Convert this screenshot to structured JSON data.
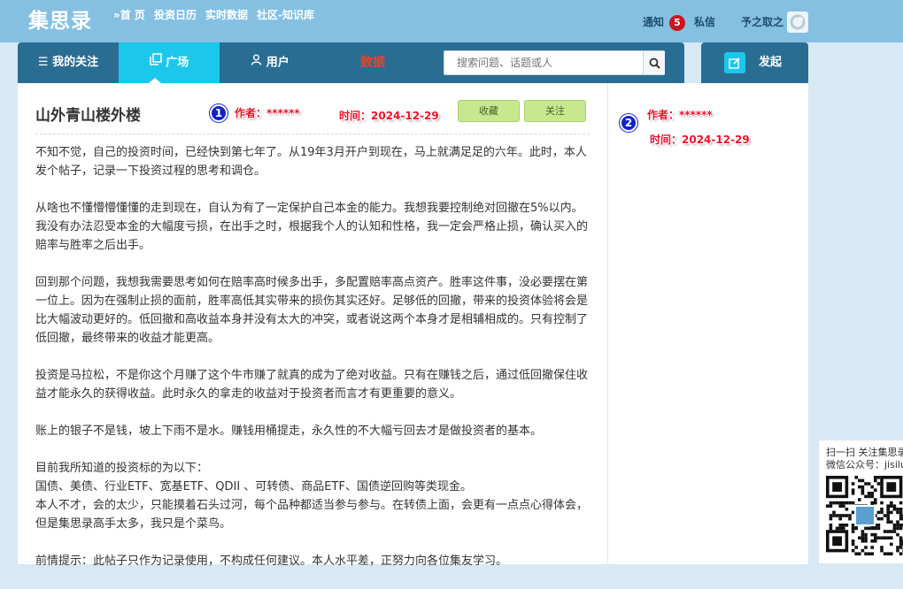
{
  "header": {
    "logo": "集思录",
    "nav": [
      "»首 页",
      "投资日历",
      "实时数据",
      "社区-知识库"
    ],
    "notice_label": "通知",
    "notice_count": "5",
    "message_label": "私信",
    "username": "予之取之"
  },
  "navbar": {
    "my_follow": "我的关注",
    "square": "广场",
    "users": "用户",
    "data": "数据",
    "search_placeholder": "搜索问题、话题或人",
    "post_button": "发起"
  },
  "colors": {
    "accent": "#1cc7ec",
    "nav_bg": "#2a6d92",
    "top_bg": "#85c0e3",
    "badge": "#c8161d",
    "data_link": "#e8412b",
    "annotation_red": "#e8132c",
    "annotation_blue": "#1222c8",
    "green_button": "#c7e88f"
  },
  "post": {
    "title": "山外青山楼外楼",
    "marker1": "1",
    "author_label": "作者：******",
    "time_label": "时间：2024-12-29",
    "collect_button": "收藏",
    "follow_button": "关注",
    "paragraphs": [
      "不知不觉，自己的投资时间，已经快到第七年了。从19年3月开户到现在，马上就满足足的六年。此时，本人发个帖子，记录一下投资过程的思考和调仓。",
      "从啥也不懂懵懵懂懂的走到现在，自认为有了一定保护自己本金的能力。我想我要控制绝对回撤在5%以内。我没有办法忍受本金的大幅度亏损，在出手之时，根据我个人的认知和性格，我一定会严格止损，确认买入的赔率与胜率之后出手。",
      "回到那个问题，我想我需要思考如何在赔率高时候多出手，多配置赔率高点资产。胜率这件事，没必要摆在第一位上。因为在强制止损的面前，胜率高低其实带来的损伤其实还好。足够低的回撤，带来的投资体验将会是比大幅波动更好的。低回撤和高收益本身并没有太大的冲突，或者说这两个本身才是相辅相成的。只有控制了低回撤，最终带来的收益才能更高。",
      "投资是马拉松，不是你这个月赚了这个牛市赚了就真的成为了绝对收益。只有在赚钱之后，通过低回撤保住收益才能永久的获得收益。此时永久的拿走的收益对于投资者而言才有更重要的意义。",
      "账上的银子不是钱，坡上下雨不是水。赚钱用桶提走，永久性的不大幅亏回去才是做投资者的基本。"
    ],
    "list_intro": "目前我所知道的投资标的为以下：",
    "list_items": "国债、美债、行业ETF、宽基ETF、QDII 、可转债、商品ETF、国债逆回购等类现金。",
    "list_note": "本人不才，会的太少，只能摸着石头过河，每个品种都适当参与参与。在转债上面，会更有一点点心得体会，但是集思录高手太多，我只是个菜鸟。",
    "disclaimer": "前情提示：此帖子只作为记录使用，不构成任何建议。本人水平差，正努力向各位集友学习。"
  },
  "sidebar": {
    "marker2": "2",
    "author_label": "作者：******",
    "time_label": "时间：2024-12-29"
  },
  "qr": {
    "line1": "扫一扫 关注集思录",
    "line2": "微信公众号：jisilu"
  }
}
